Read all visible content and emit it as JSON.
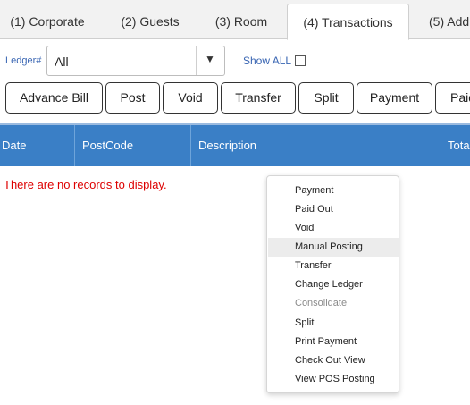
{
  "tabs": [
    {
      "label": "(1) Corporate"
    },
    {
      "label": "(2) Guests"
    },
    {
      "label": "(3) Room"
    },
    {
      "label": "(4) Transactions"
    },
    {
      "label": "(5) Add"
    }
  ],
  "filter": {
    "ledger_label": "Ledger#",
    "ledger_value": "All",
    "caret": "▼",
    "show_all_label": "Show ALL"
  },
  "toolbar": [
    {
      "label": "Advance Bill"
    },
    {
      "label": "Post"
    },
    {
      "label": "Void"
    },
    {
      "label": "Transfer"
    },
    {
      "label": "Split"
    },
    {
      "label": "Payment"
    },
    {
      "label": "Paid"
    }
  ],
  "grid": {
    "columns": [
      {
        "label": "Date"
      },
      {
        "label": "PostCode"
      },
      {
        "label": "Description"
      },
      {
        "label": "Tota"
      }
    ],
    "empty_message": "There are no records to display."
  },
  "context_menu": {
    "items": [
      {
        "label": "Payment"
      },
      {
        "label": "Paid Out"
      },
      {
        "label": "Void"
      },
      {
        "label": "Manual Posting"
      },
      {
        "label": "Transfer"
      },
      {
        "label": "Change Ledger"
      },
      {
        "label": "Consolidate"
      },
      {
        "label": "Split"
      },
      {
        "label": "Print Payment"
      },
      {
        "label": "Check Out View"
      },
      {
        "label": "View POS Posting"
      }
    ]
  },
  "colors": {
    "grid_header": "#3a7fc6",
    "link_text": "#3a66b3",
    "empty_text": "#dd0000",
    "menu_highlight": "#ececec"
  }
}
